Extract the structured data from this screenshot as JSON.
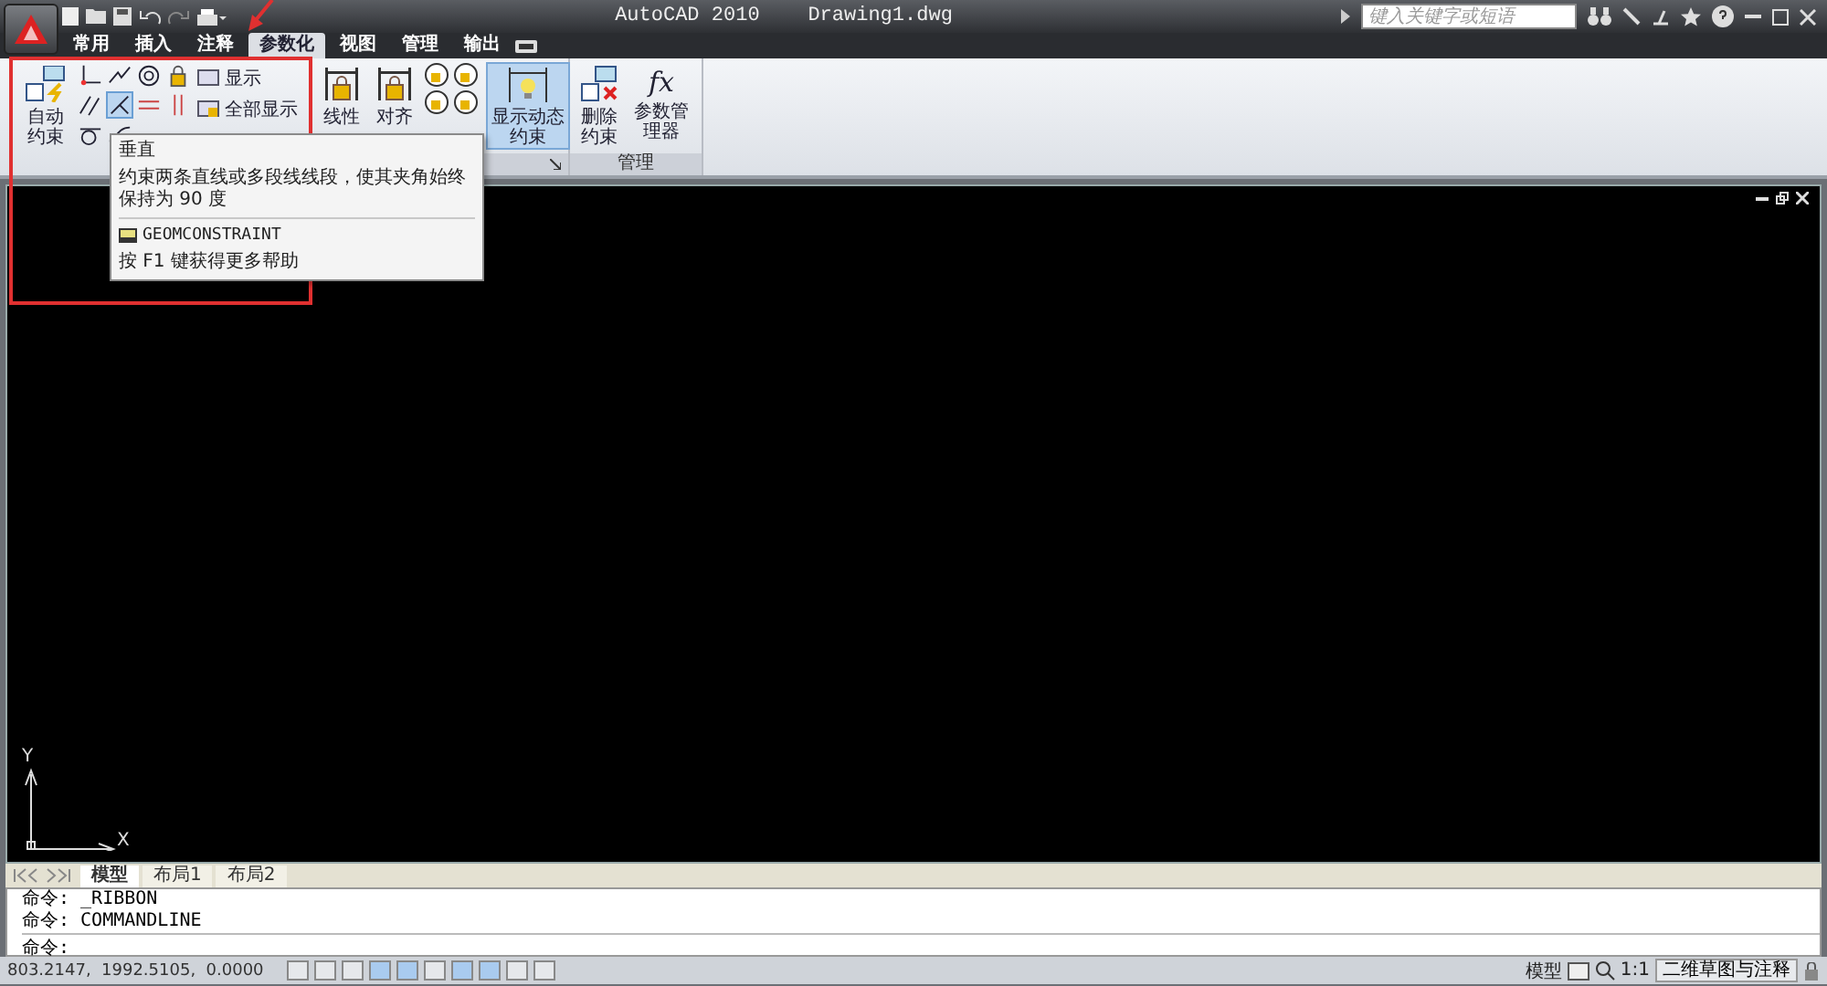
{
  "title_bar": {
    "title": "AutoCAD 2010",
    "document": "Drawing1.dwg",
    "search": {
      "placeholder": "键入关键字或短语"
    }
  },
  "tabs": [
    {
      "label": "常用",
      "selected": false
    },
    {
      "label": "插入",
      "selected": false
    },
    {
      "label": "注释",
      "selected": false
    },
    {
      "label": "参数化",
      "selected": true
    },
    {
      "label": "视图",
      "selected": false
    },
    {
      "label": "管理",
      "selected": false
    },
    {
      "label": "输出",
      "selected": false
    }
  ],
  "geometric_panel": {
    "auto_button": "自动约束",
    "tools": [
      {
        "selected": false
      },
      {
        "selected": false
      },
      {
        "selected": false
      },
      {
        "selected": false
      },
      {
        "selected": false
      },
      {
        "selected": true
      },
      {
        "selected": false
      },
      {
        "selected": false
      },
      {
        "selected": false
      },
      {
        "selected": false
      }
    ],
    "show_buttons": [
      "显示",
      "全部显示"
    ]
  },
  "dimension_panel": {
    "buttons": [
      "线性",
      "对齐"
    ],
    "dynamic_button": {
      "label": "显示动态约束",
      "selected": true
    }
  },
  "manage_panel": {
    "title": "管理",
    "buttons": [
      "删除约束",
      "参数管理器"
    ],
    "fx_icon_text": "fx"
  },
  "tooltip": {
    "title": "垂直",
    "description": "约束两条直线或多段线线段，使其夹角始终保持为 90 度",
    "command": "GEOMCONSTRAINT",
    "help": "按 F1 键获得更多帮助"
  },
  "ucs": {
    "x_label": "X",
    "y_label": "Y"
  },
  "layout_tabs": [
    {
      "label": "模型",
      "selected": true
    },
    {
      "label": "布局1",
      "selected": false
    },
    {
      "label": "布局2",
      "selected": false
    }
  ],
  "command_history": [
    "命令: _RIBBON",
    "命令: COMMANDLINE"
  ],
  "command_prompt": "命令:",
  "status_bar": {
    "coordinates": "803.2147,  1992.5105,  0.0000",
    "toggles": [
      {
        "on": false
      },
      {
        "on": false
      },
      {
        "on": false
      },
      {
        "on": true
      },
      {
        "on": true
      },
      {
        "on": false
      },
      {
        "on": true
      },
      {
        "on": true
      },
      {
        "on": false
      },
      {
        "on": false
      }
    ],
    "model_label": "模型",
    "scale": "1:1",
    "workspace": "二维草图与注释"
  }
}
